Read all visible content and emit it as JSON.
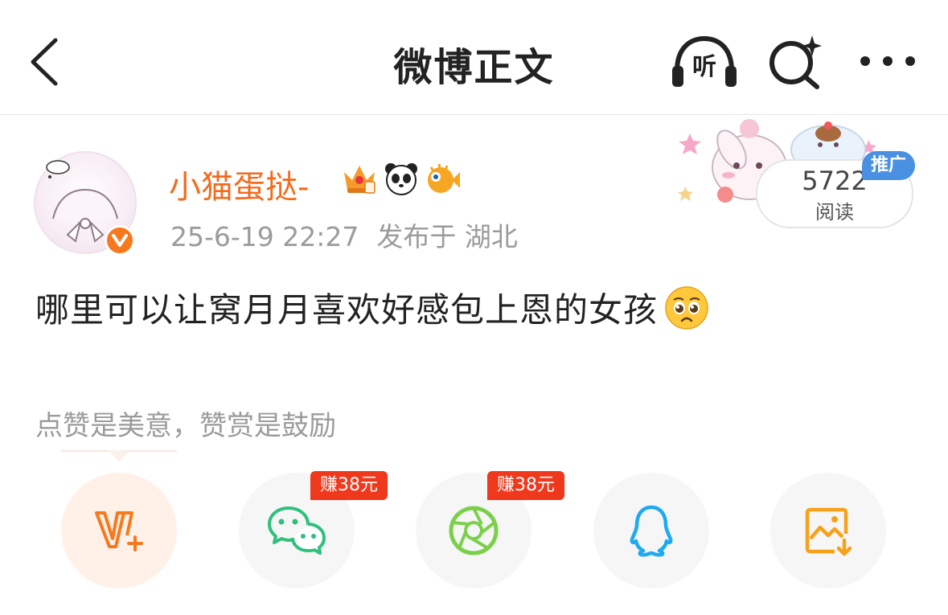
{
  "header": {
    "title": "微博正文",
    "listen_label": "听"
  },
  "post": {
    "username": "小猫蛋挞-",
    "timestamp": "25-6-19 22:27",
    "location": "发布于 湖北",
    "reads": {
      "count": "5722",
      "label": "阅读",
      "promo": "推广"
    },
    "text": "哪里可以让窝月月喜欢好感包上恩的女孩",
    "emoji": "pleading-face",
    "verified_badge": "v-badge"
  },
  "reward": {
    "note": "点赞是美意，赞赏是鼓励"
  },
  "share_buttons": [
    {
      "name": "vip-reward",
      "icon": "v-plus-icon",
      "earn_tag": ""
    },
    {
      "name": "wechat",
      "icon": "wechat-icon",
      "earn_tag": "赚38元"
    },
    {
      "name": "moments",
      "icon": "camera-aperture-icon",
      "earn_tag": "赚38元"
    },
    {
      "name": "qq",
      "icon": "qq-penguin-icon",
      "earn_tag": ""
    },
    {
      "name": "save-image",
      "icon": "save-image-icon",
      "earn_tag": ""
    }
  ],
  "colors": {
    "accent_orange": "#f36b1c",
    "promo_blue": "#4a90e2",
    "earn_red": "#f0381c",
    "wechat_green": "#2ec07c",
    "moments_green": "#7bd04a",
    "qq_blue": "#1eaaf1",
    "save_orange": "#f7a11a"
  }
}
